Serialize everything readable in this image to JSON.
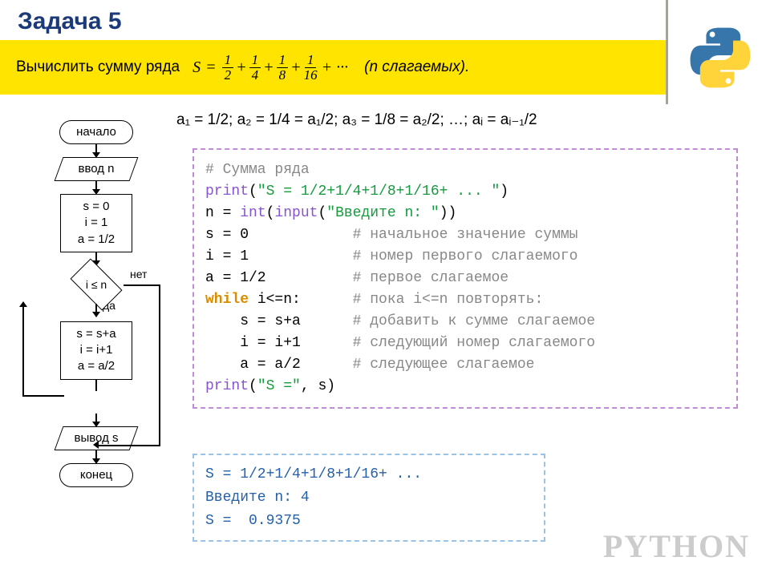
{
  "title": "Задача 5",
  "band": {
    "pre": "Вычислить сумму ряда",
    "S": "S",
    "eq": "=",
    "f1t": "1",
    "f1b": "2",
    "f2t": "1",
    "f2b": "4",
    "f3t": "1",
    "f3b": "8",
    "f4t": "1",
    "f4b": "16",
    "plus": "+",
    "dots": "+ ···",
    "post": "(n слагаемых)."
  },
  "sequence": "a₁ = 1/2;  a₂ = 1/4 = a₁/2;  a₃ = 1/8 = a₂/2; …;  aᵢ = aᵢ₋₁/2",
  "flow": {
    "start": "начало",
    "input": "ввод n",
    "init1": "s = 0",
    "init2": "i = 1",
    "init3": "a = 1/2",
    "cond": "i ≤ n",
    "yes": "да",
    "no": "нет",
    "b1": "s = s+a",
    "b2": "i = i+1",
    "b3": "a = a/2",
    "output": "вывод s",
    "end": "конец"
  },
  "code": {
    "c01": "# Сумма ряда",
    "c02a": "print",
    "c02b": "(",
    "c02s": "\"S = 1/2+1/4+1/8+1/16+ ... \"",
    "c02c": ")",
    "c03a": "n = ",
    "c03b": "int",
    "c03c": "(",
    "c03d": "input",
    "c03e": "(",
    "c03s": "\"Введите n: \"",
    "c03f": "))",
    "c04": "s = 0",
    "c04c": "# начальное значение суммы",
    "c05": "i = 1",
    "c05c": "# номер первого слагаемого",
    "c06": "a = 1/2",
    "c06c": "# первое слагаемое",
    "c07a": "while",
    "c07b": " i<=n:",
    "c07c": "# пока i<=n повторять:",
    "c08": "    s = s+a",
    "c08c": "# добавить к сумме слагаемое",
    "c09": "    i = i+1",
    "c09c": "# следующий номер слагаемого",
    "c10": "    a = a/2",
    "c10c": "# следующее слагаемое",
    "c11a": "print",
    "c11b": "(",
    "c11s": "\"S =\"",
    "c11c": ", s)"
  },
  "out": {
    "l1": "S = 1/2+1/4+1/8+1/16+ ...",
    "l2": "Введите n: 4",
    "l3": "S =  0.9375"
  },
  "wm": "PYTHON"
}
